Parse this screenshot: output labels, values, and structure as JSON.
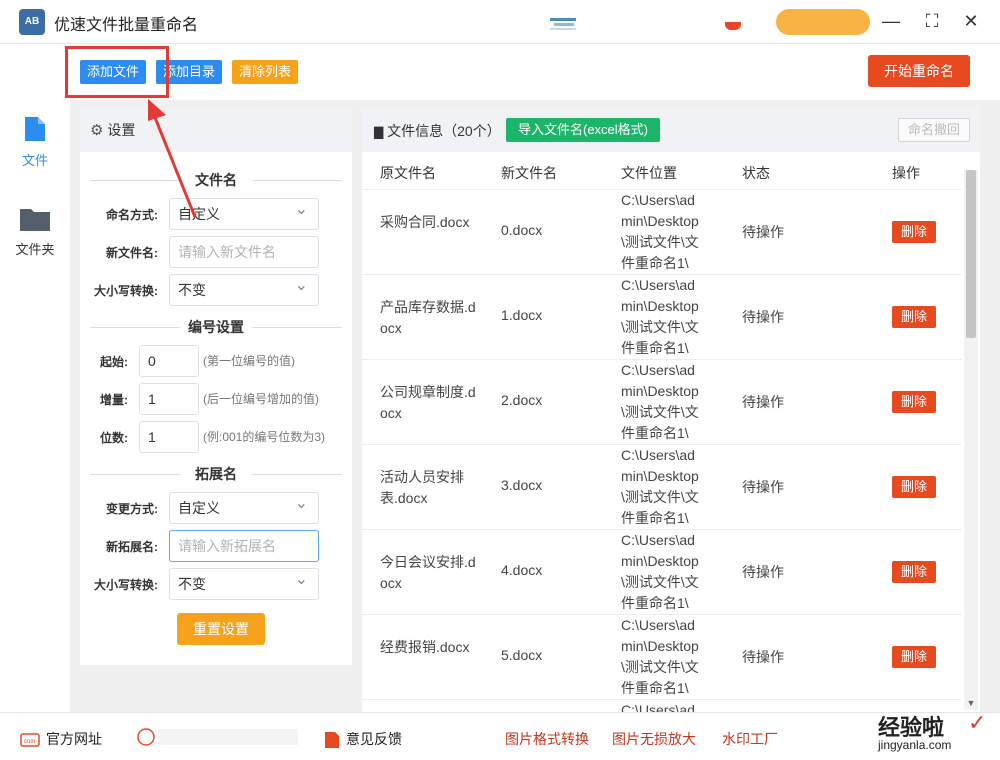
{
  "window": {
    "app_logo": "AB",
    "title": "优速文件批量重命名",
    "minimize": "—",
    "maximize": "⛶",
    "close": "✕"
  },
  "toolbar": {
    "add_file": "添加文件",
    "add_folder": "添加目录",
    "clear_list": "清除列表",
    "start": "开始重命名"
  },
  "sidebar": {
    "items": [
      {
        "label": "文件",
        "icon": "file-icon"
      },
      {
        "label": "文件夹",
        "icon": "folder-icon"
      }
    ]
  },
  "settings": {
    "title": "设置",
    "filename_section": "文件名",
    "naming_mode_label": "命名方式:",
    "naming_mode_value": "自定义",
    "new_name_label": "新文件名:",
    "new_name_placeholder": "请输入新文件名",
    "case_label": "大小写转换:",
    "case_value": "不变",
    "number_section": "编号设置",
    "start_label": "起始:",
    "start_value": "0",
    "start_hint": "(第一位编号的值)",
    "step_label": "增量:",
    "step_value": "1",
    "step_hint": "(后一位编号增加的值)",
    "digits_label": "位数:",
    "digits_value": "1",
    "digits_hint": "(例:001的编号位数为3)",
    "ext_section": "拓展名",
    "ext_mode_label": "变更方式:",
    "ext_mode_value": "自定义",
    "new_ext_label": "新拓展名:",
    "new_ext_placeholder": "请输入新拓展名",
    "ext_case_label": "大小写转换:",
    "ext_case_value": "不变",
    "reset": "重置设置"
  },
  "fileinfo": {
    "title": "文件信息（20个）",
    "import_btn": "导入文件名(excel格式)",
    "undo_btn": "命名撤回",
    "columns": [
      "原文件名",
      "新文件名",
      "文件位置",
      "状态",
      "操作"
    ],
    "rows": [
      {
        "orig": "采购合同.docx",
        "new": "0.docx",
        "loc": "C:\\Users\\admin\\Desktop\\测试文件\\文件重命名1\\",
        "status": "待操作",
        "action": "删除"
      },
      {
        "orig": "产品库存数据.docx",
        "new": "1.docx",
        "loc": "C:\\Users\\admin\\Desktop\\测试文件\\文件重命名1\\",
        "status": "待操作",
        "action": "删除"
      },
      {
        "orig": "公司规章制度.docx",
        "new": "2.docx",
        "loc": "C:\\Users\\admin\\Desktop\\测试文件\\文件重命名1\\",
        "status": "待操作",
        "action": "删除"
      },
      {
        "orig": "活动人员安排表.docx",
        "new": "3.docx",
        "loc": "C:\\Users\\admin\\Desktop\\测试文件\\文件重命名1\\",
        "status": "待操作",
        "action": "删除"
      },
      {
        "orig": "今日会议安排.docx",
        "new": "4.docx",
        "loc": "C:\\Users\\admin\\Desktop\\测试文件\\文件重命名1\\",
        "status": "待操作",
        "action": "删除"
      },
      {
        "orig": "经费报销.docx",
        "new": "5.docx",
        "loc": "C:\\Users\\admin\\Desktop\\测试文件\\文件重命名1\\",
        "status": "待操作",
        "action": "删除"
      },
      {
        "orig": "",
        "new": "",
        "loc": "C:\\Users\\ad",
        "status": "",
        "action": ""
      }
    ]
  },
  "footer": {
    "website": "官方网址",
    "feedback": "意见反馈",
    "img_convert": "图片格式转换",
    "img_enlarge": "图片无损放大",
    "watermark_factory": "水印工厂",
    "watermark_text": "经验啦",
    "watermark_url": "jingyanla.com"
  },
  "colors": {
    "primary_blue": "#2d8cf0",
    "orange": "#f7a21b",
    "red": "#e84a20",
    "green": "#1bb66a",
    "annotation_red": "#e53935"
  }
}
